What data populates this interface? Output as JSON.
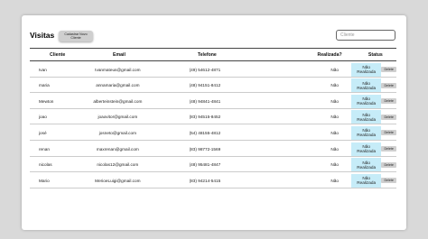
{
  "header": {
    "title": "Visitas",
    "register_button": "Cadastrar Novo\nCliente",
    "search_placeholder": "Cliente"
  },
  "table": {
    "columns": [
      "Cliente",
      "Email",
      "Telefone",
      "Realizada?",
      "Status"
    ],
    "rows": [
      {
        "cliente": "Ivan",
        "email": "Ivanmateus@gmail.com",
        "telefone": "(49) 54612-4871",
        "realizada": "Não",
        "status": "Não\nRealizada",
        "action": "Delete"
      },
      {
        "cliente": "maria",
        "email": "annamaria@gmail.com",
        "telefone": "(48) 94151-8412",
        "realizada": "Não",
        "status": "Não\nRealizada",
        "action": "Delete"
      },
      {
        "cliente": "Mewton",
        "email": "alberteinstein@gmail.com",
        "telefone": "(48) 94841-4841",
        "realizada": "Não",
        "status": "Não\nRealizada",
        "action": "Delete"
      },
      {
        "cliente": "joao",
        "email": "joaovitor@gmail.com",
        "telefone": "(83) 94515-8452",
        "realizada": "Não",
        "status": "Não\nRealizada",
        "action": "Delete"
      },
      {
        "cliente": "josé",
        "email": "josneto@gmail.com",
        "telefone": "(54) 48155-4812",
        "realizada": "Não",
        "status": "Não\nRealizada",
        "action": "Delete"
      },
      {
        "cliente": "renan",
        "email": "maxrenan@gmail.com",
        "telefone": "(83) 98772-1569",
        "realizada": "Não",
        "status": "Não\nRealizada",
        "action": "Delete"
      },
      {
        "cliente": "nicolas",
        "email": "nicolas12@gmail.com",
        "telefone": "(48) 95481-4847",
        "realizada": "Não",
        "status": "Não\nRealizada",
        "action": "Delete"
      },
      {
        "cliente": "Mario",
        "email": "MerioeLuigi@gmail.com",
        "telefone": "(83) 94214-5415",
        "realizada": "Não",
        "status": "Não\nRealizada",
        "action": "Delete"
      }
    ]
  },
  "colors": {
    "page_background": "#d9d9d9",
    "card_background": "#ffffff",
    "status_badge": "#c6ecf8",
    "delete_button": "#cfcfcf"
  }
}
